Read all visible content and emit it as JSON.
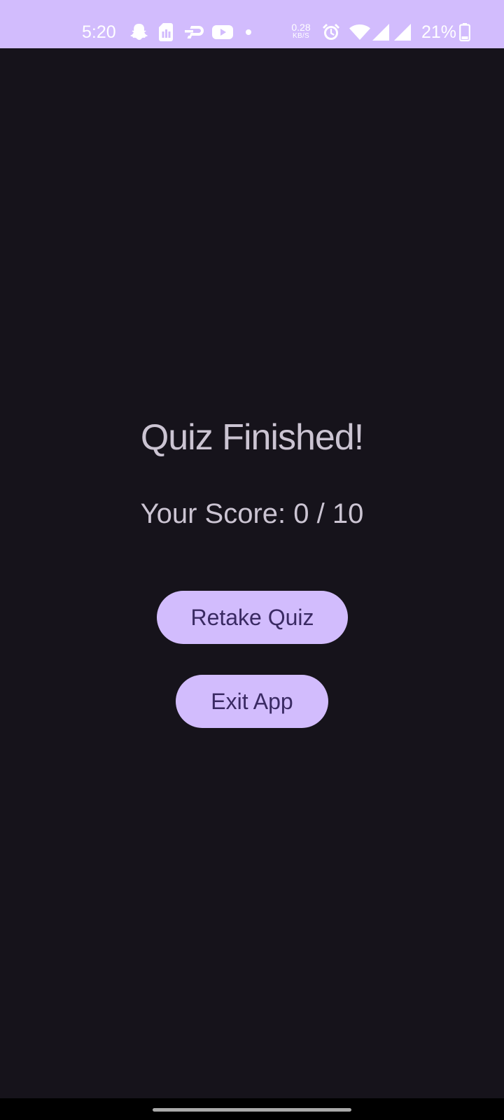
{
  "status_bar": {
    "time": "5:20",
    "net_speed_value": "0.28",
    "net_speed_unit": "KB/S",
    "battery": "21%",
    "background": "#d2bcfd",
    "icons": [
      "snapchat-icon",
      "sim-card-icon",
      "dash-app-icon",
      "youtube-icon",
      "dot-icon",
      "alarm-icon",
      "wifi-icon",
      "signal-icon",
      "signal-icon-2",
      "battery-icon"
    ]
  },
  "quiz_result": {
    "title": "Quiz Finished!",
    "score_text": "Your Score: 0 / 10"
  },
  "actions": {
    "retake_label": "Retake Quiz",
    "exit_label": "Exit App"
  },
  "colors": {
    "background": "#16131b",
    "text": "#cbc4d2",
    "button_bg": "#d2bcfd",
    "button_text": "#3a2a63"
  }
}
